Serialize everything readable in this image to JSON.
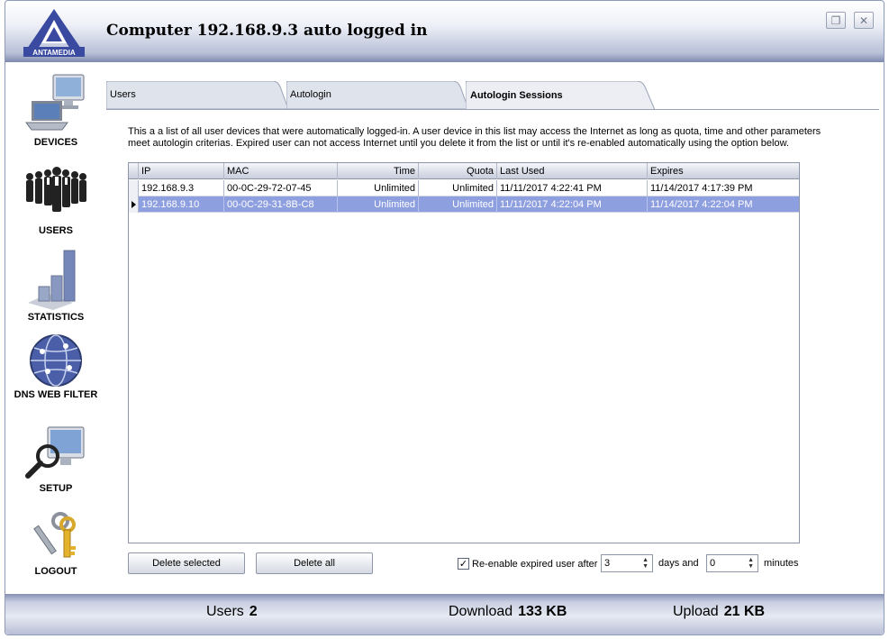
{
  "window": {
    "title": "Computer 192.168.9.3 auto logged in",
    "logo_text": "ANTAMEDIA",
    "restore_icon": "restore-icon",
    "close_icon": "close-icon"
  },
  "sidebar": {
    "items": [
      {
        "label": "DEVICES",
        "icon": "devices-icon"
      },
      {
        "label": "USERS",
        "icon": "users-icon"
      },
      {
        "label": "STATISTICS",
        "icon": "statistics-icon"
      },
      {
        "label": "DNS WEB FILTER",
        "icon": "globe-icon"
      },
      {
        "label": "SETUP",
        "icon": "setup-icon"
      },
      {
        "label": "LOGOUT",
        "icon": "keys-icon"
      }
    ]
  },
  "tabs": [
    {
      "label": "Users",
      "active": false
    },
    {
      "label": "Autologin",
      "active": false
    },
    {
      "label": "Autologin Sessions",
      "active": true
    }
  ],
  "main": {
    "description": "This a a list of all user devices that were automatically logged-in. A user device in this list may access the Internet as long as quota, time and other parameters meet autologin criterias. Expired user can not access Internet until you delete it from the list or until it's re-enabled automatically using the option below.",
    "table": {
      "columns": [
        "IP",
        "MAC",
        "Time",
        "Quota",
        "Last Used",
        "Expires"
      ],
      "rows": [
        [
          "192.168.9.3",
          "00-0C-29-72-07-45",
          "Unlimited",
          "Unlimited",
          "11/11/2017 4:22:41 PM",
          "11/14/2017 4:17:39 PM"
        ],
        [
          "192.168.9.10",
          "00-0C-29-31-8B-C8",
          "Unlimited",
          "Unlimited",
          "11/11/2017 4:22:04 PM",
          "11/14/2017 4:22:04 PM"
        ]
      ],
      "selected_row": 1
    },
    "buttons": {
      "delete_selected": "Delete selected",
      "delete_all": "Delete all"
    },
    "reenable": {
      "checked": true,
      "checkmark": "✓",
      "label": "Re-enable expired user after",
      "days_value": "3",
      "days_label": "days and",
      "minutes_value": "0",
      "minutes_label": "minutes"
    }
  },
  "status": {
    "users_label": "Users",
    "users_value": "2",
    "download_label": "Download",
    "download_value": "133 KB",
    "upload_label": "Upload",
    "upload_value": "21 KB"
  },
  "colors": {
    "selection": "#8e9fe0",
    "header_gradient_dark": "#7e89ad"
  }
}
